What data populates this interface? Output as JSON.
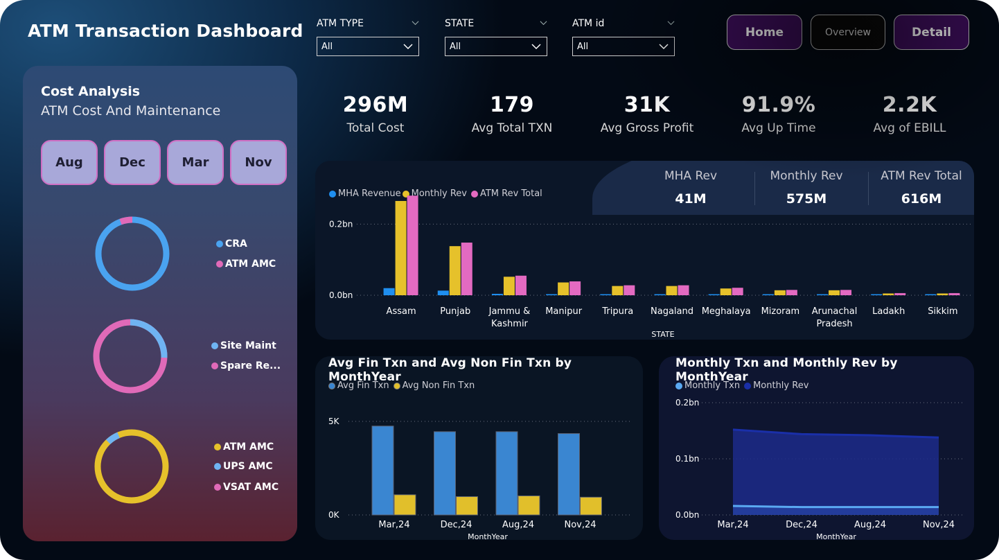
{
  "header": {
    "title": "ATM Transaction Dashboard"
  },
  "slicers": [
    {
      "label": "ATM TYPE",
      "value": "All"
    },
    {
      "label": "STATE",
      "value": "All"
    },
    {
      "label": "ATM id",
      "value": "All"
    }
  ],
  "nav": {
    "home": "Home",
    "overview": "Overview",
    "detail": "Detail"
  },
  "cost_panel": {
    "title": "Cost Analysis",
    "subtitle": "ATM Cost And Maintenance",
    "months": [
      "Aug",
      "Dec",
      "Mar",
      "Nov"
    ],
    "donut1": {
      "legend": [
        "CRA",
        "ATM AMC"
      ]
    },
    "donut2": {
      "legend": [
        "Site Maint",
        "Spare Re..."
      ]
    },
    "donut3": {
      "legend": [
        "ATM AMC",
        "UPS AMC",
        "VSAT AMC"
      ]
    }
  },
  "kpis": [
    {
      "value": "296M",
      "label": "Total Cost"
    },
    {
      "value": "179",
      "label": "Avg Total TXN"
    },
    {
      "value": "31K",
      "label": "Avg Gross Profit"
    },
    {
      "value": "91.9%",
      "label": "Avg Up Time"
    },
    {
      "value": "2.2K",
      "label": "Avg of EBILL"
    }
  ],
  "rev_kpis": [
    {
      "label": "MHA Rev",
      "value": "41M"
    },
    {
      "label": "Monthly Rev",
      "value": "575M"
    },
    {
      "label": "ATM Rev Total",
      "value": "616M"
    }
  ],
  "colors": {
    "mha": "#1f8ff0",
    "monthly": "#e6c12b",
    "atmtotal": "#e36ac1",
    "blue_light": "#4aa3f0",
    "pink": "#e06ab8",
    "yellow": "#e6c12b",
    "fin": "#3a86d1",
    "nonfin": "#e1bf2b",
    "txn_line": "#5aa9f2",
    "rev_line": "#1a2fa8"
  },
  "chart_data": [
    {
      "type": "bar",
      "xlabel": "STATE",
      "ylabel": "",
      "categories": [
        "Assam",
        "Punjab",
        "Jammu & Kashmir",
        "Manipur",
        "Tripura",
        "Nagaland",
        "Meghalaya",
        "Mizoram",
        "Arunachal Pradesh",
        "Ladakh",
        "Sikkim"
      ],
      "series": [
        {
          "name": "MHA Revenue",
          "values": [
            0.02,
            0.013,
            0.004,
            0.003,
            0.002,
            0.002,
            0.002,
            0.001,
            0.001,
            0.001,
            0.001
          ]
        },
        {
          "name": "Monthly Rev",
          "values": [
            0.265,
            0.138,
            0.052,
            0.036,
            0.026,
            0.026,
            0.019,
            0.014,
            0.014,
            0.005,
            0.005
          ]
        },
        {
          "name": "ATM Rev Total",
          "values": [
            0.28,
            0.148,
            0.055,
            0.039,
            0.028,
            0.028,
            0.021,
            0.015,
            0.015,
            0.006,
            0.006
          ]
        }
      ],
      "yticks": [
        "0.0bn",
        "0.2bn"
      ],
      "ytick_values": [
        0,
        0.2
      ],
      "ylim": [
        0,
        0.3
      ]
    },
    {
      "type": "bar",
      "title": "Avg Fin Txn and Avg Non Fin Txn by MonthYear",
      "xlabel": "MonthYear",
      "categories": [
        "Mar,24",
        "Dec,24",
        "Aug,24",
        "Nov,24"
      ],
      "series": [
        {
          "name": "Avg Fin Txn",
          "values": [
            4750,
            4450,
            4450,
            4350
          ]
        },
        {
          "name": "Avg Non Fin Txn",
          "values": [
            1080,
            980,
            1020,
            950
          ]
        }
      ],
      "yticks": [
        "0K",
        "5K"
      ],
      "ytick_values": [
        0,
        5000
      ],
      "ylim": [
        0,
        5000
      ]
    },
    {
      "type": "area",
      "title": "Monthly Txn and Monthly Rev by MonthYear",
      "xlabel": "MonthYear",
      "categories": [
        "Mar,24",
        "Dec,24",
        "Aug,24",
        "Nov,24"
      ],
      "series": [
        {
          "name": "Monthly Txn",
          "values": [
            0.016,
            0.014,
            0.014,
            0.014
          ]
        },
        {
          "name": "Monthly Rev",
          "values": [
            0.152,
            0.144,
            0.142,
            0.138
          ]
        }
      ],
      "yticks": [
        "0.0bn",
        "0.1bn",
        "0.2bn"
      ],
      "ytick_values": [
        0,
        0.1,
        0.2
      ],
      "ylim": [
        0,
        0.2
      ]
    }
  ]
}
